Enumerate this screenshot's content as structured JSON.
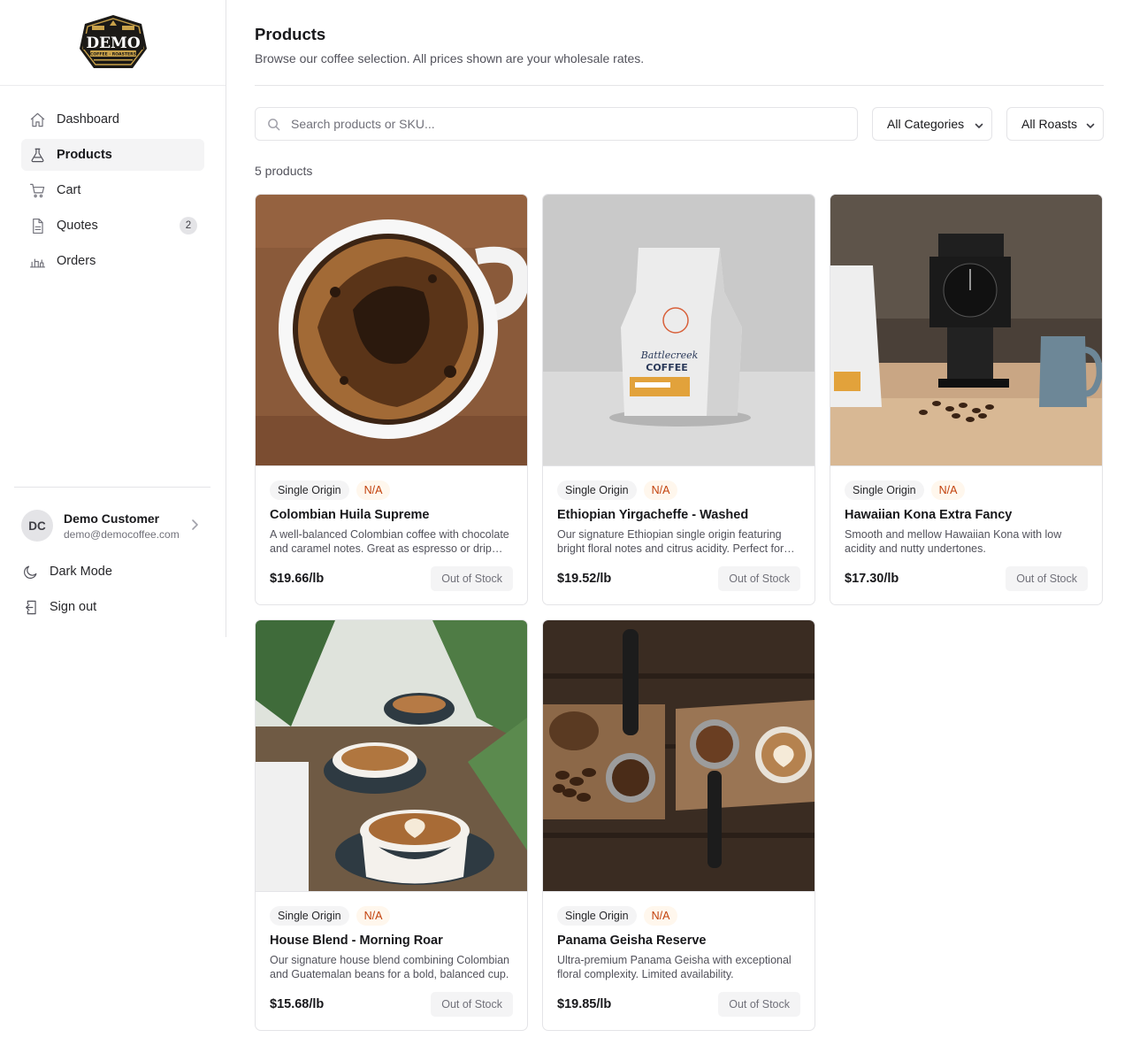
{
  "brand": {
    "logo_text": "DEMO",
    "logo_subtext": "COFFEE · ROASTERS"
  },
  "nav": [
    {
      "label": "Dashboard",
      "icon": "home-icon"
    },
    {
      "label": "Products",
      "icon": "flask-icon",
      "active": true
    },
    {
      "label": "Cart",
      "icon": "cart-icon"
    },
    {
      "label": "Quotes",
      "icon": "document-icon",
      "badge": "2"
    },
    {
      "label": "Orders",
      "icon": "orders-icon"
    }
  ],
  "user": {
    "initials": "DC",
    "name": "Demo Customer",
    "email": "demo@democoffee.com"
  },
  "bottom": {
    "dark_mode": "Dark Mode",
    "sign_out": "Sign out"
  },
  "page": {
    "title": "Products",
    "subtitle": "Browse our coffee selection. All prices shown are your wholesale rates.",
    "search_placeholder": "Search products or SKU...",
    "category_filter": "All Categories",
    "roast_filter": "All Roasts",
    "count_text": "5 products"
  },
  "products": [
    {
      "category": "Single Origin",
      "roast": "N/A",
      "name": "Colombian Huila Supreme",
      "description": "A well-balanced Colombian coffee with chocolate and caramel notes. Great as espresso or drip coffee.",
      "price": "$19.66/lb",
      "stock": "Out of Stock"
    },
    {
      "category": "Single Origin",
      "roast": "N/A",
      "name": "Ethiopian Yirgacheffe - Washed",
      "description": "Our signature Ethiopian single origin featuring bright floral notes and citrus acidity. Perfect for pour over.",
      "price": "$19.52/lb",
      "stock": "Out of Stock"
    },
    {
      "category": "Single Origin",
      "roast": "N/A",
      "name": "Hawaiian Kona Extra Fancy",
      "description": "Smooth and mellow Hawaiian Kona with low acidity and nutty undertones.",
      "price": "$17.30/lb",
      "stock": "Out of Stock"
    },
    {
      "category": "Single Origin",
      "roast": "N/A",
      "name": "House Blend - Morning Roar",
      "description": "Our signature house blend combining Colombian and Guatemalan beans for a bold, balanced cup.",
      "price": "$15.68/lb",
      "stock": "Out of Stock"
    },
    {
      "category": "Single Origin",
      "roast": "N/A",
      "name": "Panama Geisha Reserve",
      "description": "Ultra-premium Panama Geisha with exceptional floral complexity. Limited availability.",
      "price": "$19.85/lb",
      "stock": "Out of Stock"
    }
  ],
  "colors": {
    "accent_tag_bg": "#fff7ed",
    "accent_tag_text": "#c2410c",
    "active_nav_bg": "#f4f4f5",
    "border": "#e4e4e7"
  }
}
